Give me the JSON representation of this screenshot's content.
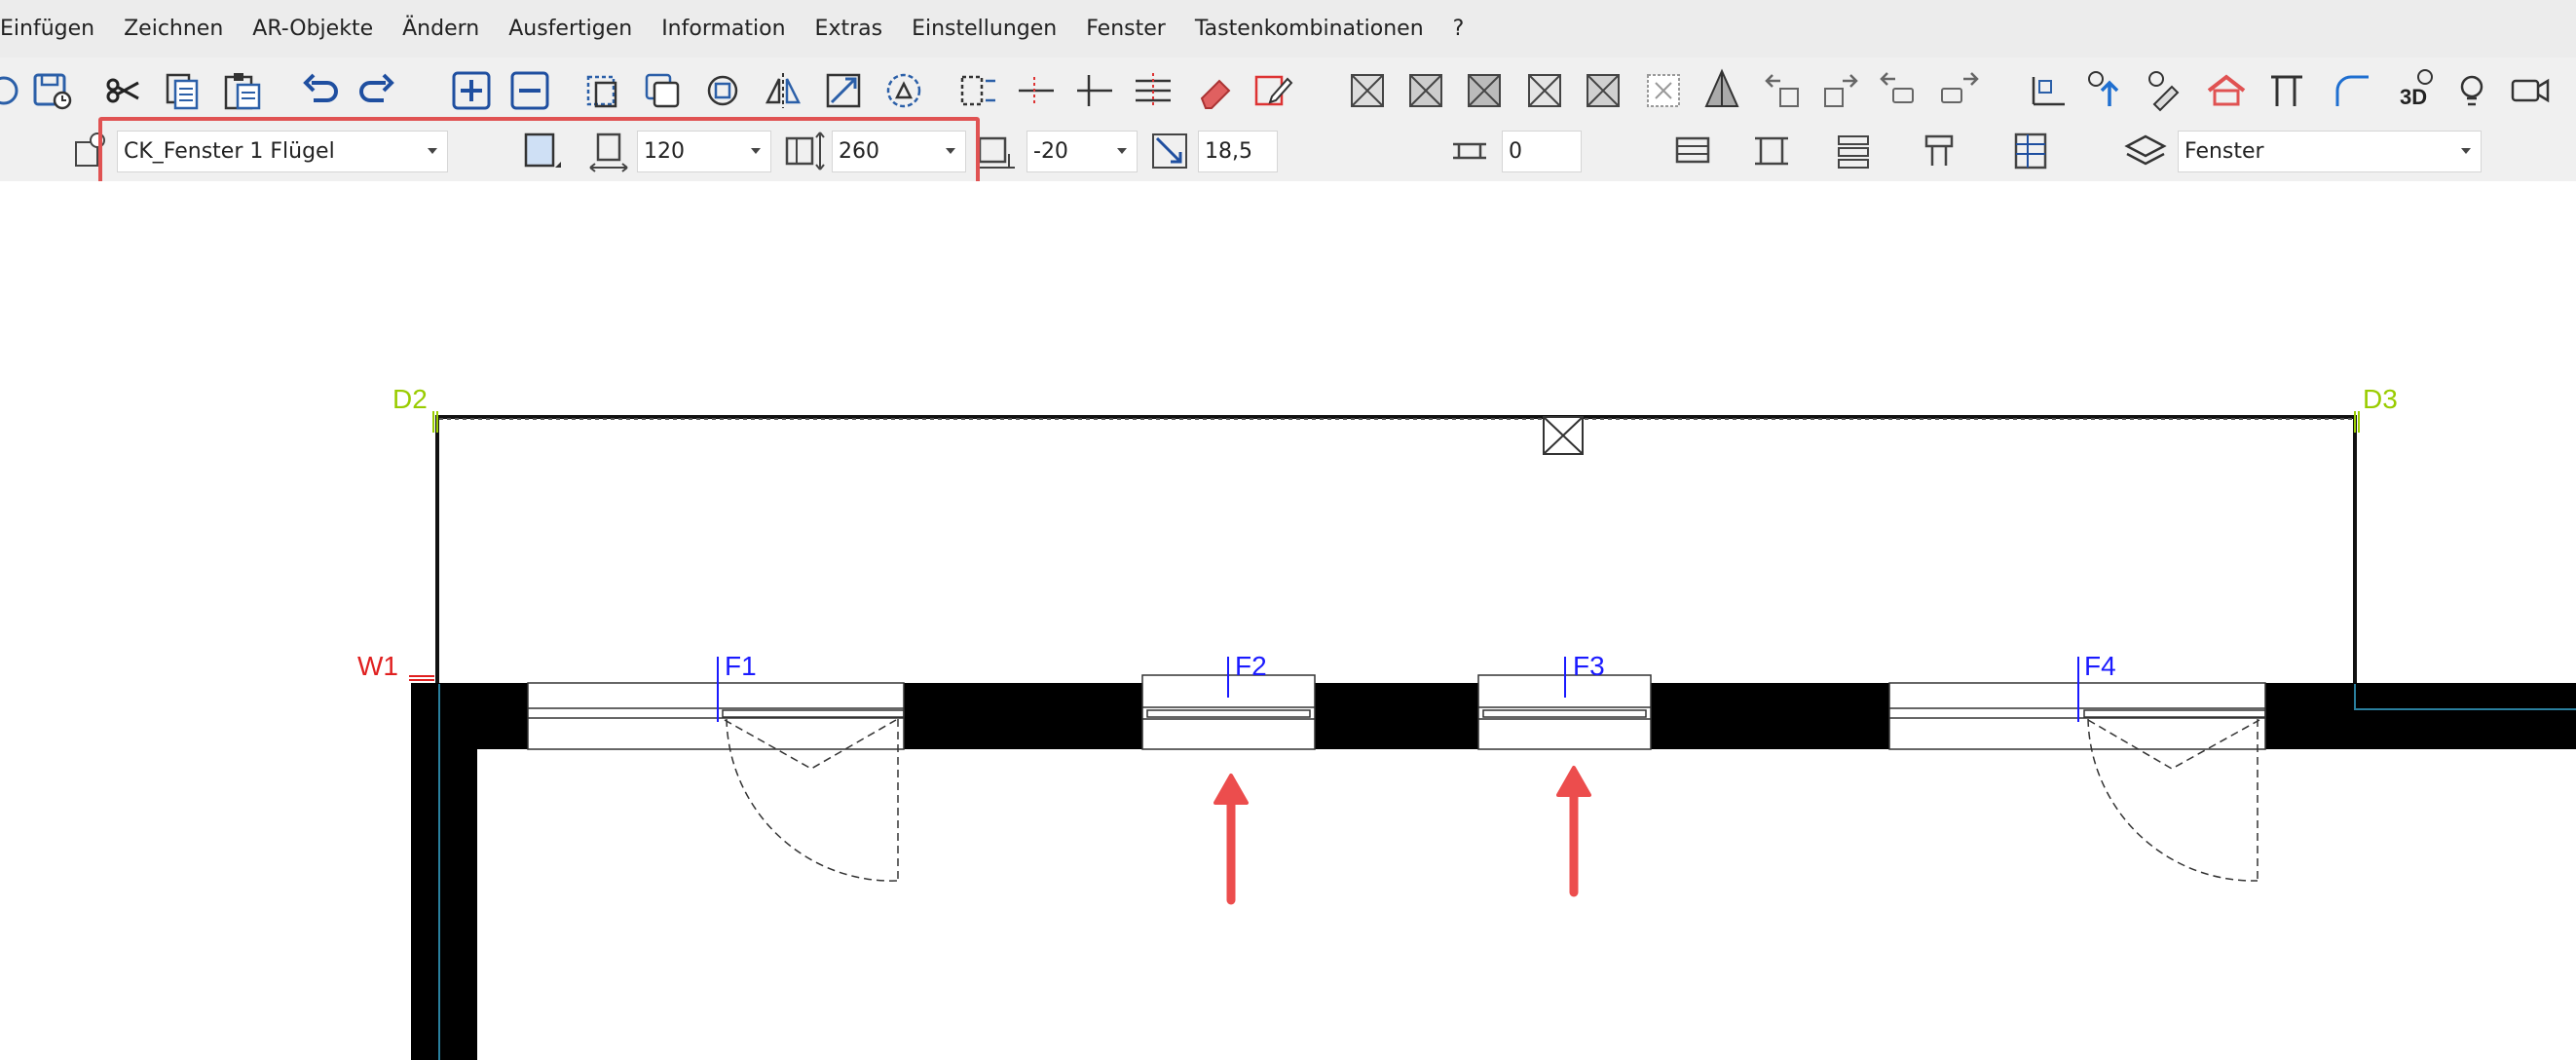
{
  "menu": [
    "Einfügen",
    "Zeichnen",
    "AR-Objekte",
    "Ändern",
    "Ausfertigen",
    "Information",
    "Extras",
    "Einstellungen",
    "Fenster",
    "Tastenkombinationen",
    "?"
  ],
  "props": {
    "type": "CK_Fenster 1 Flügel",
    "width": "120",
    "height": "260",
    "sill": "-20",
    "offset": "18,5",
    "frame": "0",
    "layer": "Fenster"
  },
  "plan": {
    "axis_labels": [
      "D2",
      "D3",
      "W1"
    ],
    "window_labels": [
      "F1",
      "F2",
      "F3",
      "F4"
    ],
    "colors": {
      "axis_green": "#99cc00",
      "axis_red": "#e02020",
      "window_blue": "#1a1aff",
      "arrow_red": "#ec4d4d",
      "highlight": "#e05252"
    }
  },
  "toolbar_icons": [
    "refresh-icon",
    "save-icon",
    "cut-icon",
    "copy-icon",
    "paste-icon",
    "undo-icon",
    "redo-icon",
    "zoom-in-icon",
    "zoom-out-icon",
    "select-icon",
    "duplicate-icon",
    "rotate-icon",
    "mirror-icon",
    "scale-icon",
    "modify-icon",
    "dimension-icon",
    "line-icon",
    "offset-icon",
    "hatch-icon",
    "eraser-icon",
    "pencil-icon",
    "view-icon",
    "pyramid-icon",
    "arrow-icon",
    "light-icon",
    "camera-icon"
  ]
}
